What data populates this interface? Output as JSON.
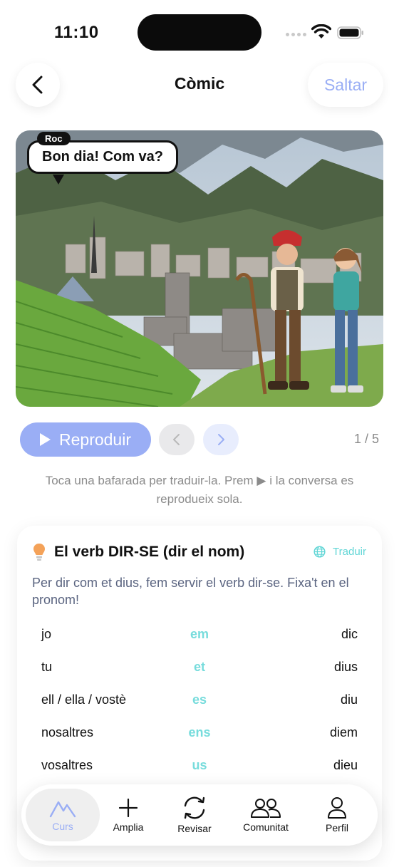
{
  "status_bar": {
    "time": "11:10"
  },
  "header": {
    "title": "Còmic",
    "skip_label": "Saltar"
  },
  "comic": {
    "speaker": "Roc",
    "bubble_text": "Bon dia! Com va?"
  },
  "controls": {
    "play_label": "Reproduir",
    "page_counter": "1 / 5"
  },
  "hint": "Toca una bafarada per traduir-la. Prem ▶ i la conversa es reprodueix sola.",
  "grammar_card": {
    "title": "El verb DIR-SE (dir el nom)",
    "translate_label": "Traduir",
    "description": "Per dir com et dius, fem servir el verb dir-se. Fixa't en el pronom!",
    "rows": [
      {
        "pronoun": "jo",
        "reflexive": "em",
        "verb": "dic"
      },
      {
        "pronoun": "tu",
        "reflexive": "et",
        "verb": "dius"
      },
      {
        "pronoun": "ell / ella / vostè",
        "reflexive": "es",
        "verb": "diu"
      },
      {
        "pronoun": "nosaltres",
        "reflexive": "ens",
        "verb": "diem"
      },
      {
        "pronoun": "vosaltres",
        "reflexive": "us",
        "verb": "dieu"
      }
    ]
  },
  "tabbar": {
    "items": [
      {
        "label": "Curs",
        "icon": "mountain-icon",
        "active": true
      },
      {
        "label": "Amplia",
        "icon": "plus-icon",
        "active": false
      },
      {
        "label": "Revisar",
        "icon": "refresh-icon",
        "active": false
      },
      {
        "label": "Comunitat",
        "icon": "people-icon",
        "active": false
      },
      {
        "label": "Perfil",
        "icon": "person-icon",
        "active": false
      }
    ]
  },
  "colors": {
    "accent": "#9aaef5",
    "teal": "#62d6d6",
    "bulb": "#f4a259"
  }
}
